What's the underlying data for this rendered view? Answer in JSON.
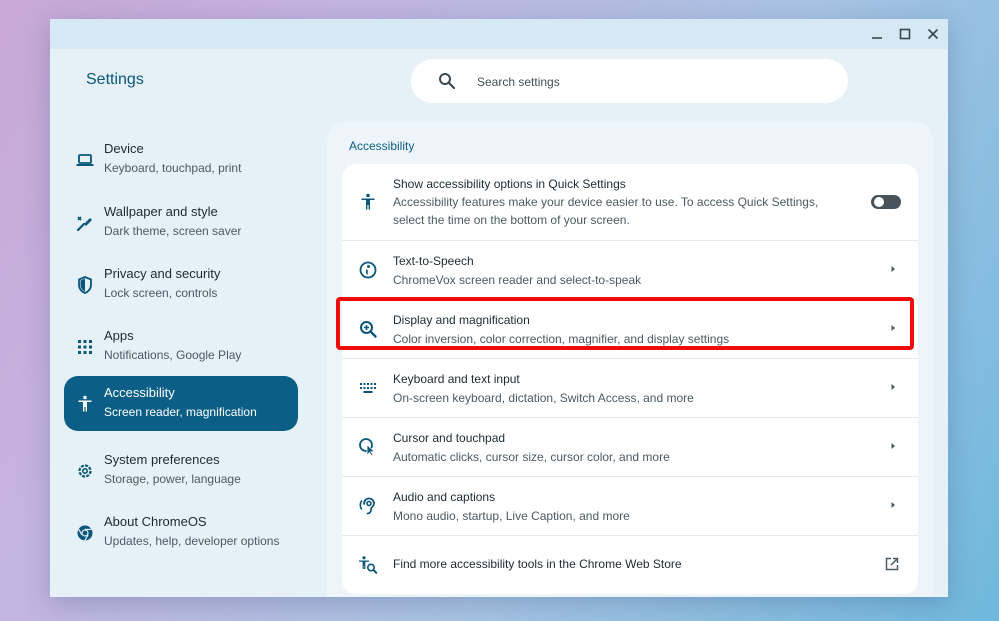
{
  "window": {
    "title": "Settings",
    "controls": [
      "minimize-icon",
      "maximize-icon",
      "close-icon"
    ]
  },
  "search": {
    "placeholder": "Search settings",
    "value": ""
  },
  "sidebar": {
    "items": [
      {
        "title": "Device",
        "subtitle": "Keyboard, touchpad, print",
        "icon": "laptop-icon",
        "active": false
      },
      {
        "title": "Wallpaper and style",
        "subtitle": "Dark theme, screen saver",
        "icon": "paintbrush-icon",
        "active": false
      },
      {
        "title": "Privacy and security",
        "subtitle": "Lock screen, controls",
        "icon": "shield-icon",
        "active": false
      },
      {
        "title": "Apps",
        "subtitle": "Notifications, Google Play",
        "icon": "apps-grid-icon",
        "active": false
      },
      {
        "title": "Accessibility",
        "subtitle": "Screen reader, magnification",
        "icon": "accessibility-icon",
        "active": true
      },
      {
        "title": "System preferences",
        "subtitle": "Storage, power, language",
        "icon": "gear-icon",
        "active": false
      },
      {
        "title": "About ChromeOS",
        "subtitle": "Updates, help, developer options",
        "icon": "chrome-icon",
        "active": false
      }
    ]
  },
  "main": {
    "section_title": "Accessibility",
    "rows": [
      {
        "title": "Show accessibility options in Quick Settings",
        "subtitle": "Accessibility features make your device easier to use. To access Quick Settings, select the time on the bottom of your screen.",
        "icon": "accessibility-icon",
        "control": "toggle",
        "toggle_on": false
      },
      {
        "title": "Text-to-Speech",
        "subtitle": "ChromeVox screen reader and select-to-speak",
        "icon": "text-to-speech-icon",
        "control": "arrow"
      },
      {
        "title": "Display and magnification",
        "subtitle": "Color inversion, color correction, magnifier, and display settings",
        "icon": "zoom-in-icon",
        "control": "arrow",
        "highlighted": true
      },
      {
        "title": "Keyboard and text input",
        "subtitle": "On-screen keyboard, dictation, Switch Access, and more",
        "icon": "keyboard-icon",
        "control": "arrow"
      },
      {
        "title": "Cursor and touchpad",
        "subtitle": "Automatic clicks, cursor size, cursor color, and more",
        "icon": "cursor-icon",
        "control": "arrow"
      },
      {
        "title": "Audio and captions",
        "subtitle": "Mono audio, startup, Live Caption, and more",
        "icon": "hearing-icon",
        "control": "arrow"
      },
      {
        "title": "Find more accessibility tools in the Chrome Web Store",
        "icon": "accessibility-search-icon",
        "control": "external-link"
      }
    ]
  },
  "colors": {
    "accent": "#0b5e86",
    "window_bg": "#e6f0f7",
    "highlight": "#f00c0c",
    "toggle_off": "#48525a"
  }
}
